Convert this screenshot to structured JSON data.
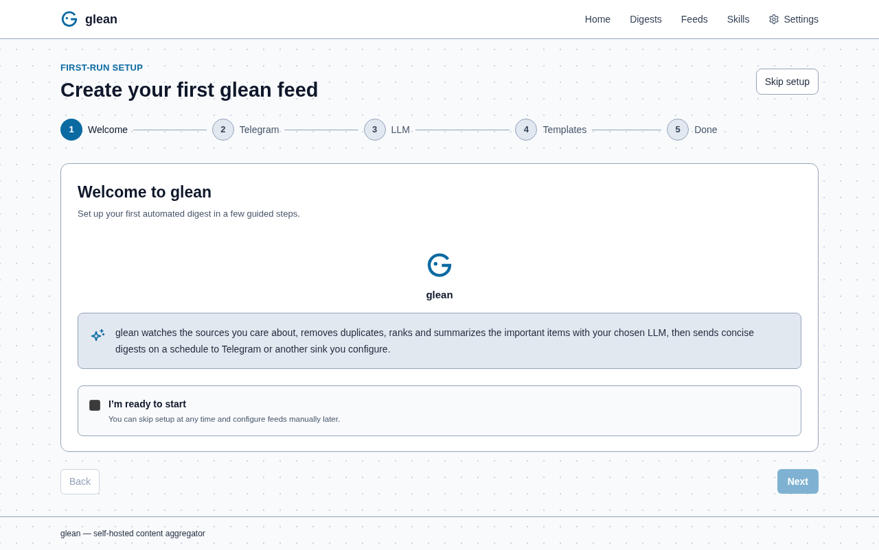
{
  "header": {
    "brand": "glean",
    "nav": [
      {
        "label": "Home",
        "kind": "link"
      },
      {
        "label": "Digests",
        "kind": "link"
      },
      {
        "label": "Feeds",
        "kind": "link"
      },
      {
        "label": "Skills",
        "kind": "link"
      },
      {
        "label": "Settings",
        "kind": "settings"
      }
    ]
  },
  "page": {
    "eyebrow": "FIRST-RUN SETUP",
    "title": "Create your first glean feed",
    "skip_button": "Skip setup"
  },
  "steps": [
    {
      "number": "1",
      "label": "Welcome",
      "selected": true
    },
    {
      "number": "2",
      "label": "Telegram",
      "selected": false
    },
    {
      "number": "3",
      "label": "LLM",
      "selected": false
    },
    {
      "number": "4",
      "label": "Templates",
      "selected": false
    },
    {
      "number": "5",
      "label": "Done",
      "selected": false
    }
  ],
  "card": {
    "title": "Welcome to glean",
    "subtitle": "Set up your first automated digest in a few guided steps.",
    "logo_label": "glean",
    "info": "glean watches the sources you care about, removes duplicates, ranks and summarizes the important items with your chosen LLM, then sends concise digests on a schedule to Telegram or another sink you configure.",
    "ready": {
      "label": "I’m ready to start",
      "hint": "You can skip setup at any time and configure feeds manually later.",
      "checked": false
    }
  },
  "actions": {
    "back": {
      "label": "Back",
      "disabled": true
    },
    "next": {
      "label": "Next",
      "disabled": true
    }
  },
  "footer": "glean — self-hosted content aggregator"
}
